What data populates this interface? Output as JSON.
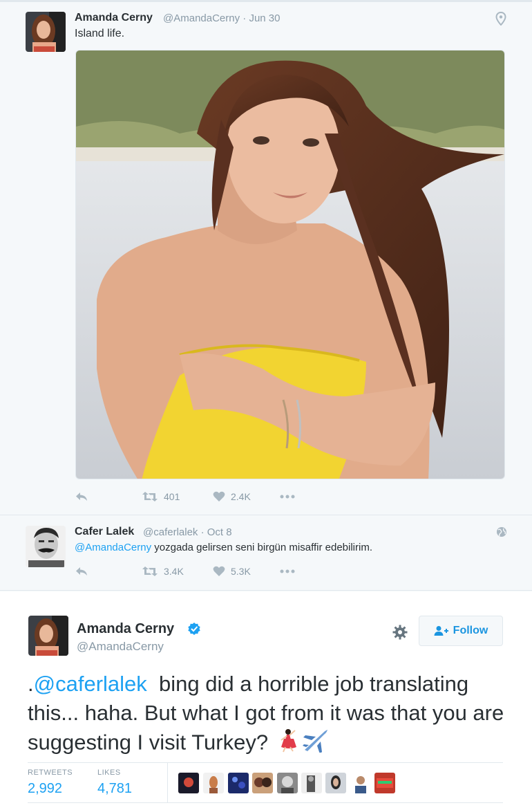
{
  "tweet1": {
    "name": "Amanda Cerny",
    "handle": "@AmandaCerny · Jun 30",
    "text": "Island life.",
    "actions": {
      "retweets": "401",
      "likes": "2.4K"
    }
  },
  "tweet2": {
    "name": "Cafer Lalek",
    "handle": "@caferlalek · Oct 8",
    "mention": "@AmandaCerny",
    "text": " yozgada gelirsen seni birgün misaffir edebilirim.",
    "actions": {
      "retweets": "3.4K",
      "likes": "5.3K"
    }
  },
  "main": {
    "name": "Amanda Cerny",
    "handle": "@AmandaCerny",
    "follow_label": "Follow",
    "text_prefix": ".",
    "mention": "@caferlalek",
    "text": "  bing did a horrible job translating this... haha. But what I got from it was that you are suggesting I visit Turkey? ",
    "stats": {
      "retweets_label": "RETWEETS",
      "retweets_value": "2,992",
      "likes_label": "LIKES",
      "likes_value": "4,781"
    }
  },
  "colors": {
    "accent": "#1da1f2",
    "muted": "#8899a6",
    "verified": "#1da1f2"
  }
}
